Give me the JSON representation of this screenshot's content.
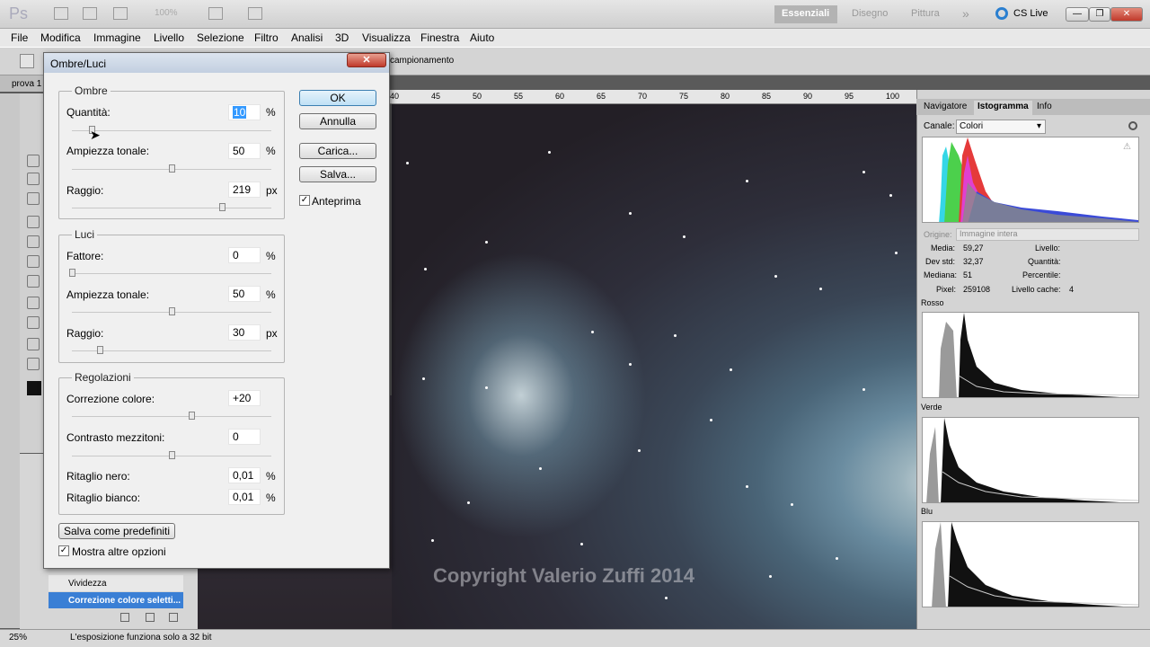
{
  "app": {
    "logo": "Ps",
    "zoom_level": "100%"
  },
  "workspaces": {
    "essenziali": "Essenziali",
    "disegno": "Disegno",
    "pittura": "Pittura",
    "more": "»",
    "cslive": "CS Live"
  },
  "window_buttons": {
    "minimize": "—",
    "restore": "❐",
    "close": "✕"
  },
  "menu": [
    "File",
    "Modifica",
    "Immagine",
    "Livello",
    "Selezione",
    "Filtro",
    "Analisi",
    "3D",
    "Visualizza",
    "Finestra",
    "Aiuto"
  ],
  "options": {
    "text": "campionamento"
  },
  "document": {
    "tab": "prova 1"
  },
  "ruler": [
    "40",
    "45",
    "50",
    "55",
    "60",
    "65",
    "70",
    "75",
    "80",
    "85",
    "90",
    "95",
    "100"
  ],
  "canvas": {
    "copyright": "Copyright Valerio Zuffi 2014"
  },
  "layers": {
    "vividezza": "Vividezza",
    "selected": "Correzione colore seletti..."
  },
  "status": {
    "zoom": "25%",
    "message": "L'esposizione funziona solo a 32 bit"
  },
  "panel": {
    "tabs": [
      "Navigatore",
      "Istogramma",
      "Info"
    ],
    "canale_label": "Canale:",
    "canale_value": "Colori",
    "origine_label": "Origine:",
    "origine_value": "Immagine intera",
    "stats_left": [
      {
        "k": "Media:",
        "v": "59,27"
      },
      {
        "k": "Dev std:",
        "v": "32,37"
      },
      {
        "k": "Mediana:",
        "v": "51"
      },
      {
        "k": "Pixel:",
        "v": "259108"
      }
    ],
    "stats_right": [
      {
        "k": "Livello:",
        "v": ""
      },
      {
        "k": "Quantità:",
        "v": ""
      },
      {
        "k": "Percentile:",
        "v": ""
      },
      {
        "k": "Livello cache:",
        "v": "4"
      }
    ],
    "channels": [
      "Rosso",
      "Verde",
      "Blu"
    ]
  },
  "dialog": {
    "title": "Ombre/Luci",
    "close": "✕",
    "ombre": {
      "title": "Ombre",
      "quantita_label": "Quantità:",
      "quantita_value": "10",
      "quantita_unit": "%",
      "quantita_frac": 0.1,
      "ampiezza_label": "Ampiezza tonale:",
      "ampiezza_value": "50",
      "ampiezza_unit": "%",
      "ampiezza_frac": 0.5,
      "raggio_label": "Raggio:",
      "raggio_value": "219",
      "raggio_unit": "px",
      "raggio_frac": 0.75
    },
    "luci": {
      "title": "Luci",
      "fattore_label": "Fattore:",
      "fattore_value": "0",
      "fattore_unit": "%",
      "fattore_frac": 0.0,
      "ampiezza_label": "Ampiezza tonale:",
      "ampiezza_value": "50",
      "ampiezza_unit": "%",
      "ampiezza_frac": 0.5,
      "raggio_label": "Raggio:",
      "raggio_value": "30",
      "raggio_unit": "px",
      "raggio_frac": 0.14
    },
    "regolazioni": {
      "title": "Regolazioni",
      "colore_label": "Correzione colore:",
      "colore_value": "+20",
      "colore_frac": 0.6,
      "contrasto_label": "Contrasto mezzitoni:",
      "contrasto_value": "0",
      "contrasto_frac": 0.5,
      "nero_label": "Ritaglio nero:",
      "nero_value": "0,01",
      "nero_unit": "%",
      "bianco_label": "Ritaglio bianco:",
      "bianco_value": "0,01",
      "bianco_unit": "%"
    },
    "buttons": {
      "ok": "OK",
      "annulla": "Annulla",
      "carica": "Carica...",
      "salva": "Salva..."
    },
    "anteprima": "Anteprima",
    "salva_predefiniti": "Salva come predefiniti",
    "mostra_opzioni": "Mostra altre opzioni",
    "check_mark": "✓"
  }
}
